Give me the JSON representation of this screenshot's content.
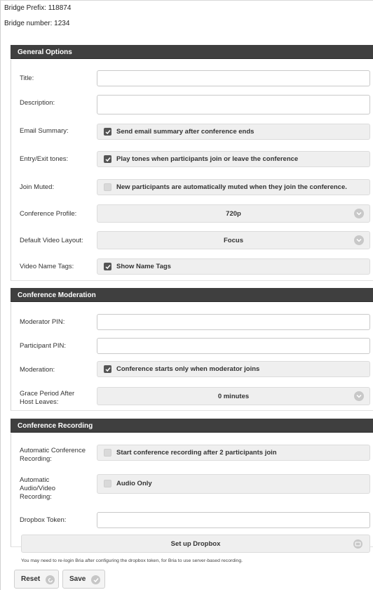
{
  "bridge": {
    "prefix_text": "Bridge Prefix: 118874",
    "number_text": "Bridge number: 1234"
  },
  "general": {
    "heading": "General Options",
    "title_label": "Title:",
    "title_value": "",
    "description_label": "Description:",
    "description_value": "",
    "email_label": "Email Summary:",
    "email_text": "Send email summary after conference ends",
    "email_checked": true,
    "tones_label": "Entry/Exit tones:",
    "tones_text": "Play tones when participants join or leave the conference",
    "tones_checked": true,
    "muted_label": "Join Muted:",
    "muted_text": "New participants are automatically muted when they join the conference.",
    "muted_checked": false,
    "profile_label": "Conference Profile:",
    "profile_value": "720p",
    "layout_label": "Default Video Layout:",
    "layout_value": "Focus",
    "nametags_label": "Video Name Tags:",
    "nametags_text": "Show Name Tags",
    "nametags_checked": true
  },
  "moderation": {
    "heading": "Conference Moderation",
    "moderator_pin_label": "Moderator PIN:",
    "moderator_pin_value": "",
    "participant_pin_label": "Participant PIN:",
    "participant_pin_value": "",
    "moderation_label": "Moderation:",
    "moderation_text": "Conference starts only when moderator joins",
    "moderation_checked": true,
    "grace_label": "Grace Period After Host Leaves:",
    "grace_value": "0 minutes"
  },
  "recording": {
    "heading": "Conference Recording",
    "auto_label": "Automatic Conference Recording:",
    "auto_text": "Start conference recording after 2 participants join",
    "auto_checked": false,
    "av_label": "Automatic Audio/Video Recording:",
    "av_text": "Audio Only",
    "av_checked": false,
    "dropbox_label": "Dropbox Token:",
    "dropbox_value": "",
    "dropbox_button": "Set up Dropbox",
    "note": "You may need to re-login Bria after configuring the dropbox token, for Bria to use server-based recording."
  },
  "actions": {
    "reset_label": "Reset",
    "save_label": "Save"
  },
  "icons": {
    "checkbox": "checkmark-icon",
    "select": "chevron-down-icon",
    "dropbox": "cloud-icon",
    "reset": "reset-icon",
    "save": "checkmark-icon"
  }
}
